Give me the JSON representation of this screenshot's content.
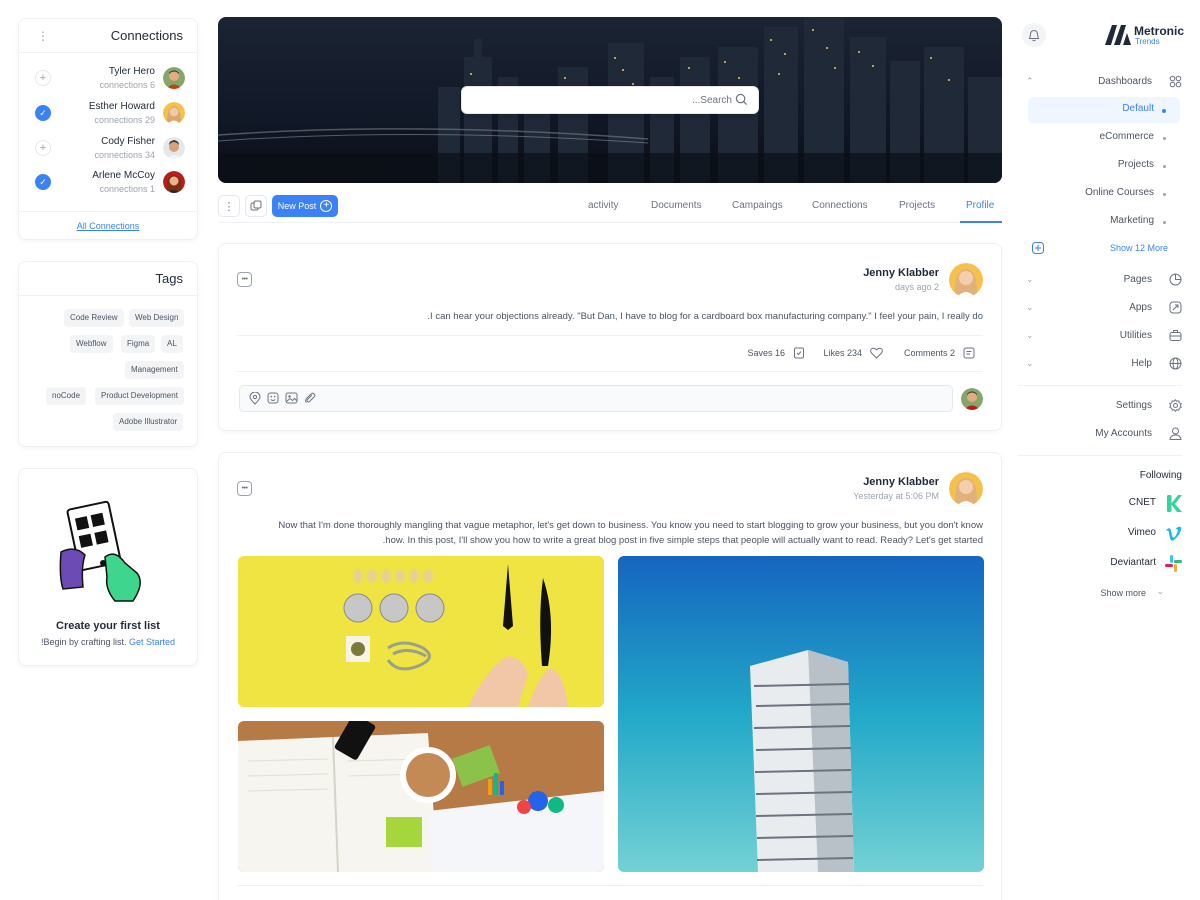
{
  "connections": {
    "title": "Connections",
    "items": [
      {
        "name": "Tyler Hero",
        "sub": "connections 6",
        "state": "+"
      },
      {
        "name": "Esther Howard",
        "sub": "connections 29",
        "state": "✓"
      },
      {
        "name": "Cody Fisher",
        "sub": "connections 34",
        "state": "+"
      },
      {
        "name": "Arlene McCoy",
        "sub": "connections 1",
        "state": "✓"
      }
    ],
    "all_link": "All Connections"
  },
  "tags": {
    "title": "Tags",
    "items": [
      "Code Review",
      "Web Design",
      "Webflow",
      "Figma",
      "AL",
      "Management",
      "noCode",
      "Product Development",
      "Adobe Illustrator"
    ]
  },
  "create_list": {
    "title": "Create your first list",
    "text": "!Begin by crafting list.",
    "link": "Get Started"
  },
  "search": {
    "placeholder": "...Search"
  },
  "toolbar": {
    "new_post": "New Post",
    "plus": "+",
    "dots": "⋮"
  },
  "tabs": [
    "activity",
    "Documents",
    "Campaings",
    "Connections",
    "Projects",
    "Profile"
  ],
  "posts": [
    {
      "author": "Jenny Klabber",
      "time": "days ago 2",
      "text": ".I can hear your objections already. \"But Dan, I have to blog for a cardboard box manufacturing company.\" I feel your pain, I really do",
      "saves": "Saves 16",
      "likes": "Likes 234",
      "comments": "Comments 2"
    },
    {
      "author": "Jenny Klabber",
      "time": "Yesterday at 5:06 PM",
      "text_line1": "Now that I'm done thoroughly mangling that vague metaphor, let's get down to business. You know you need to start blogging to grow your business, but you don't know",
      "text_line2": ".how. In this post, I'll show you how to write a great blog post in five simple steps that people will actually want to read. Ready? Let's get started"
    }
  ],
  "brand": {
    "name": "Metronic",
    "sub": "Trends"
  },
  "nav": {
    "dashboards": "Dashboards",
    "sub": [
      "Default",
      "eCommerce",
      "Projects",
      "Online Courses",
      "Marketing"
    ],
    "show_more": "Show 12 More",
    "pages": "Pages",
    "apps": "Apps",
    "utilities": "Utilities",
    "help": "Help",
    "settings": "Settings",
    "accounts": "My Accounts"
  },
  "following": {
    "title": "Following",
    "items": [
      "CNET",
      "Vimeo",
      "Deviantart"
    ],
    "show_more": "Show more"
  },
  "colors": {
    "accent": "#3b82f6",
    "text": "#1f2937",
    "muted": "#9ca3af"
  }
}
